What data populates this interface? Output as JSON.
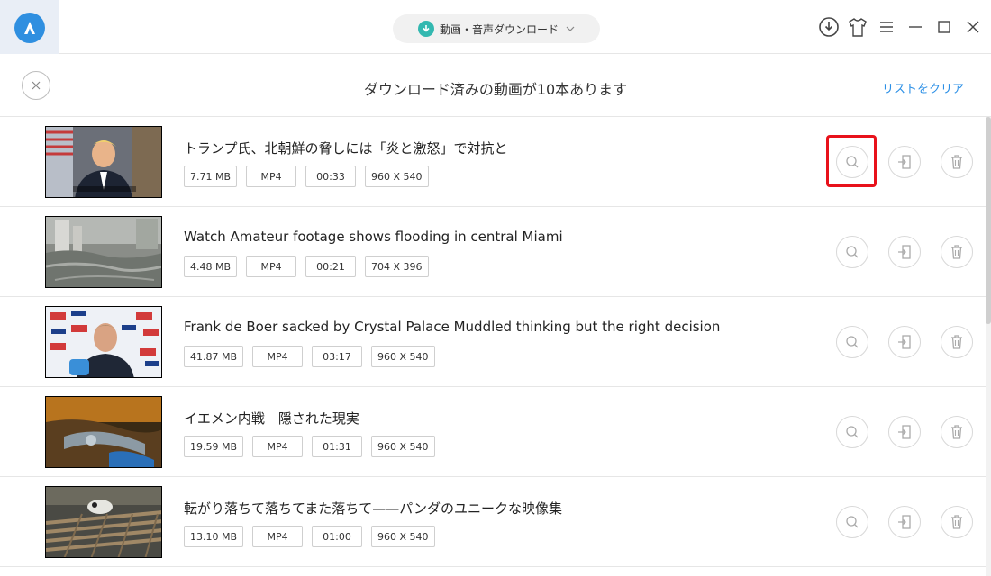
{
  "titlebar": {
    "mode_label": "動画・音声ダウンロード",
    "icons": [
      "app-logo-icon",
      "download-mode-icon",
      "chevron-down-icon",
      "download-circle-icon",
      "tshirt-icon",
      "menu-icon",
      "minimize-icon",
      "maximize-icon",
      "close-icon"
    ]
  },
  "header": {
    "title": "ダウンロード済みの動画が10本あります",
    "clear_label": "リストをクリア"
  },
  "colors": {
    "accent": "#2b8fe6",
    "highlight": "#e8121b",
    "teal": "#33b8b0"
  },
  "items": [
    {
      "title": "トランプ氏、北朝鮮の脅しには「炎と激怒」で対抗と",
      "size": "7.71 MB",
      "format": "MP4",
      "duration": "00:33",
      "resolution": "960 X 540"
    },
    {
      "title": "Watch Amateur footage shows flooding in central Miami",
      "size": "4.48 MB",
      "format": "MP4",
      "duration": "00:21",
      "resolution": "704 X 396"
    },
    {
      "title": "Frank de Boer sacked by Crystal Palace Muddled thinking but the right decision",
      "size": "41.87 MB",
      "format": "MP4",
      "duration": "03:17",
      "resolution": "960 X 540"
    },
    {
      "title": "イエメン内戦　隠された現実",
      "size": "19.59 MB",
      "format": "MP4",
      "duration": "01:31",
      "resolution": "960 X 540"
    },
    {
      "title": "転がり落ちて落ちてまた落ちて——パンダのユニークな映像集",
      "size": "13.10 MB",
      "format": "MP4",
      "duration": "01:00",
      "resolution": "960 X 540"
    }
  ]
}
